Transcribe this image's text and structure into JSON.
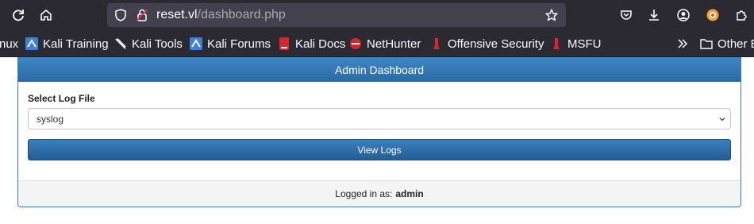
{
  "browser": {
    "url_host": "reset.vl",
    "url_path": "/dashboard.php",
    "bookmarks": [
      {
        "label": "nux",
        "icon": "none"
      },
      {
        "label": "Kali Training",
        "icon": "kali-dragon-icon"
      },
      {
        "label": "Kali Tools",
        "icon": "kali-dragon-icon"
      },
      {
        "label": "Kali Forums",
        "icon": "kali-dragon-icon"
      },
      {
        "label": "Kali Docs",
        "icon": "kali-docs-icon"
      },
      {
        "label": "NetHunter",
        "icon": "nethunter-icon"
      },
      {
        "label": "Offensive Security",
        "icon": "offsec-icon"
      },
      {
        "label": "MSFU",
        "icon": "offsec-icon"
      },
      {
        "label": "Other B",
        "icon": "folder-icon"
      }
    ]
  },
  "dashboard": {
    "title": "Admin Dashboard",
    "select_label": "Select Log File",
    "selected_log": "syslog",
    "view_button": "View Logs",
    "logged_in_prefix": "Logged in as:",
    "username": "admin"
  },
  "colors": {
    "browser_chrome": "#2b2a33",
    "urlbar": "#42414d",
    "panel_header": "#2f6fab",
    "button": "#2d6aa5",
    "footer": "#f4f4f4"
  }
}
